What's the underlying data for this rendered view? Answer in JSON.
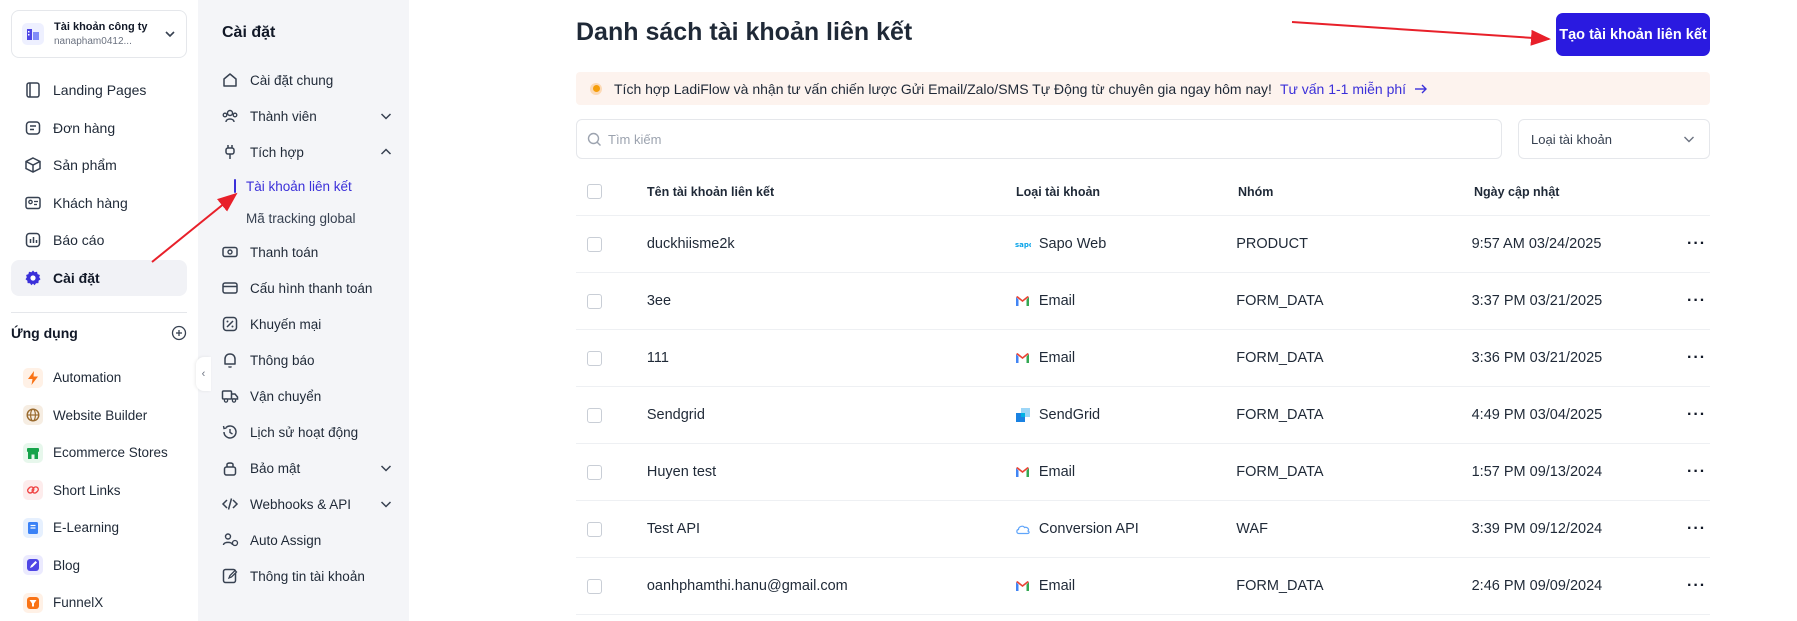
{
  "account": {
    "name": "Tài khoản công ty",
    "email": "nanapham0412..."
  },
  "nav": {
    "items": [
      {
        "label": "Landing Pages",
        "icon": "landing-pages-icon"
      },
      {
        "label": "Đơn hàng",
        "icon": "orders-icon"
      },
      {
        "label": "Sản phẩm",
        "icon": "box-icon"
      },
      {
        "label": "Khách hàng",
        "icon": "contact-card-icon"
      },
      {
        "label": "Báo cáo",
        "icon": "chart-icon"
      },
      {
        "label": "Cài đặt",
        "icon": "gear-icon",
        "active": true
      }
    ],
    "apps_title": "Ứng dụng",
    "apps": [
      {
        "label": "Automation",
        "icon": "bolt-icon",
        "color": "#f97316"
      },
      {
        "label": "Website Builder",
        "icon": "globe-icon",
        "color": "#9a6b2f"
      },
      {
        "label": "Ecommerce Stores",
        "icon": "store-icon",
        "color": "#16a34a"
      },
      {
        "label": "Short Links",
        "icon": "link-icon",
        "color": "#ef4444"
      },
      {
        "label": "E-Learning",
        "icon": "book-icon",
        "color": "#3b82f6"
      },
      {
        "label": "Blog",
        "icon": "blog-icon",
        "color": "#4f46e5"
      },
      {
        "label": "FunnelX",
        "icon": "funnel-icon",
        "color": "#f97316"
      }
    ]
  },
  "settings": {
    "title": "Cài đặt",
    "items": {
      "general": "Cài đặt chung",
      "members": "Thành viên",
      "integration": "Tích hợp",
      "linked_accounts": "Tài khoản liên kết",
      "tracking": "Mã tracking global",
      "payment": "Thanh toán",
      "payment_config": "Cấu hình thanh toán",
      "promotion": "Khuyến mại",
      "notifications": "Thông báo",
      "shipping": "Vận chuyển",
      "activity": "Lịch sử hoạt động",
      "security": "Bảo mật",
      "webhooks": "Webhooks & API",
      "auto_assign": "Auto Assign",
      "account_info": "Thông tin tài khoản"
    }
  },
  "main": {
    "title": "Danh sách tài khoản liên kết",
    "create_button": "Tạo tài khoản liên kết",
    "banner_text": "Tích hợp LadiFlow và nhận tư vấn chiến lược Gửi Email/Zalo/SMS Tự Động từ chuyên gia ngay hôm nay!",
    "banner_link": "Tư vấn 1-1 miễn phí",
    "search_placeholder": "Tìm kiếm",
    "filter_label": "Loại tài khoản",
    "columns": {
      "name": "Tên tài khoản liên kết",
      "type": "Loại tài khoản",
      "group": "Nhóm",
      "updated": "Ngày cập nhật"
    },
    "rows": [
      {
        "name": "duckhiisme2k",
        "type": "Sapo Web",
        "type_icon": "sapo-icon",
        "group": "PRODUCT",
        "updated": "9:57 AM 03/24/2025"
      },
      {
        "name": "3ee",
        "type": "Email",
        "type_icon": "gmail-icon",
        "group": "FORM_DATA",
        "updated": "3:37 PM 03/21/2025"
      },
      {
        "name": "111",
        "type": "Email",
        "type_icon": "gmail-icon",
        "group": "FORM_DATA",
        "updated": "3:36 PM 03/21/2025"
      },
      {
        "name": "Sendgrid",
        "type": "SendGrid",
        "type_icon": "sendgrid-icon",
        "group": "FORM_DATA",
        "updated": "4:49 PM 03/04/2025"
      },
      {
        "name": "Huyen test",
        "type": "Email",
        "type_icon": "gmail-icon",
        "group": "FORM_DATA",
        "updated": "1:57 PM 09/13/2024"
      },
      {
        "name": "Test API",
        "type": "Conversion API",
        "type_icon": "cloud-icon",
        "group": "WAF",
        "updated": "3:39 PM 09/12/2024"
      },
      {
        "name": "oanhphamthi.hanu@gmail.com",
        "type": "Email",
        "type_icon": "gmail-icon",
        "group": "FORM_DATA",
        "updated": "2:46 PM 09/09/2024"
      }
    ]
  },
  "colors": {
    "accent": "#2a1ae0",
    "active_link": "#3b30d9",
    "banner_bg": "#fdf3ee",
    "annotation_arrow": "#e8202a"
  }
}
